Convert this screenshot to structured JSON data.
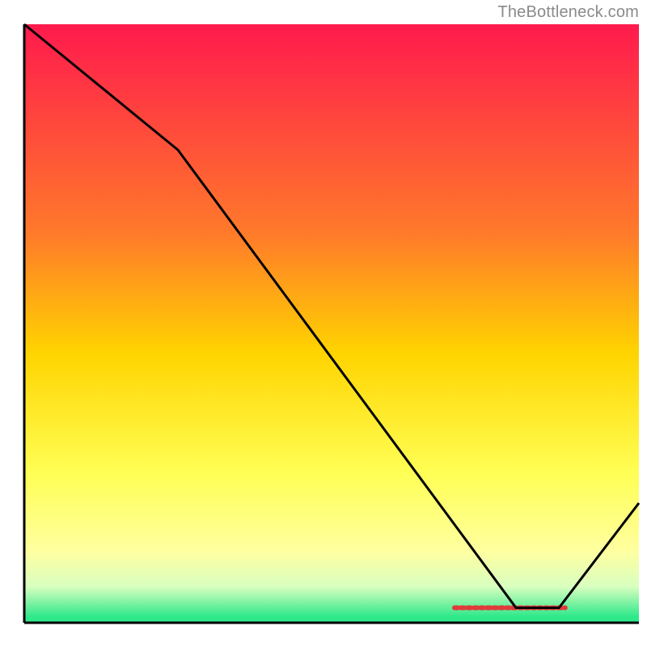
{
  "attribution": "TheBottleneck.com",
  "chart_data": {
    "type": "line",
    "title": "",
    "xlabel": "",
    "ylabel": "",
    "xlim": [
      0,
      100
    ],
    "ylim": [
      0,
      100
    ],
    "x": [
      0,
      25,
      80,
      87,
      100
    ],
    "values": [
      100,
      79,
      2.5,
      2.5,
      20
    ],
    "optimal_band": {
      "x_from": 70,
      "x_to": 88,
      "y": 2.5
    },
    "gradient_stops": [
      {
        "offset": 0.0,
        "color": "#ff1a4d"
      },
      {
        "offset": 0.35,
        "color": "#ff7a2a"
      },
      {
        "offset": 0.55,
        "color": "#ffd400"
      },
      {
        "offset": 0.75,
        "color": "#ffff55"
      },
      {
        "offset": 0.88,
        "color": "#ffffa0"
      },
      {
        "offset": 0.94,
        "color": "#d8ffc0"
      },
      {
        "offset": 0.99,
        "color": "#2fe88a"
      }
    ],
    "axis_color": "#000000",
    "line_color": "#000000"
  }
}
